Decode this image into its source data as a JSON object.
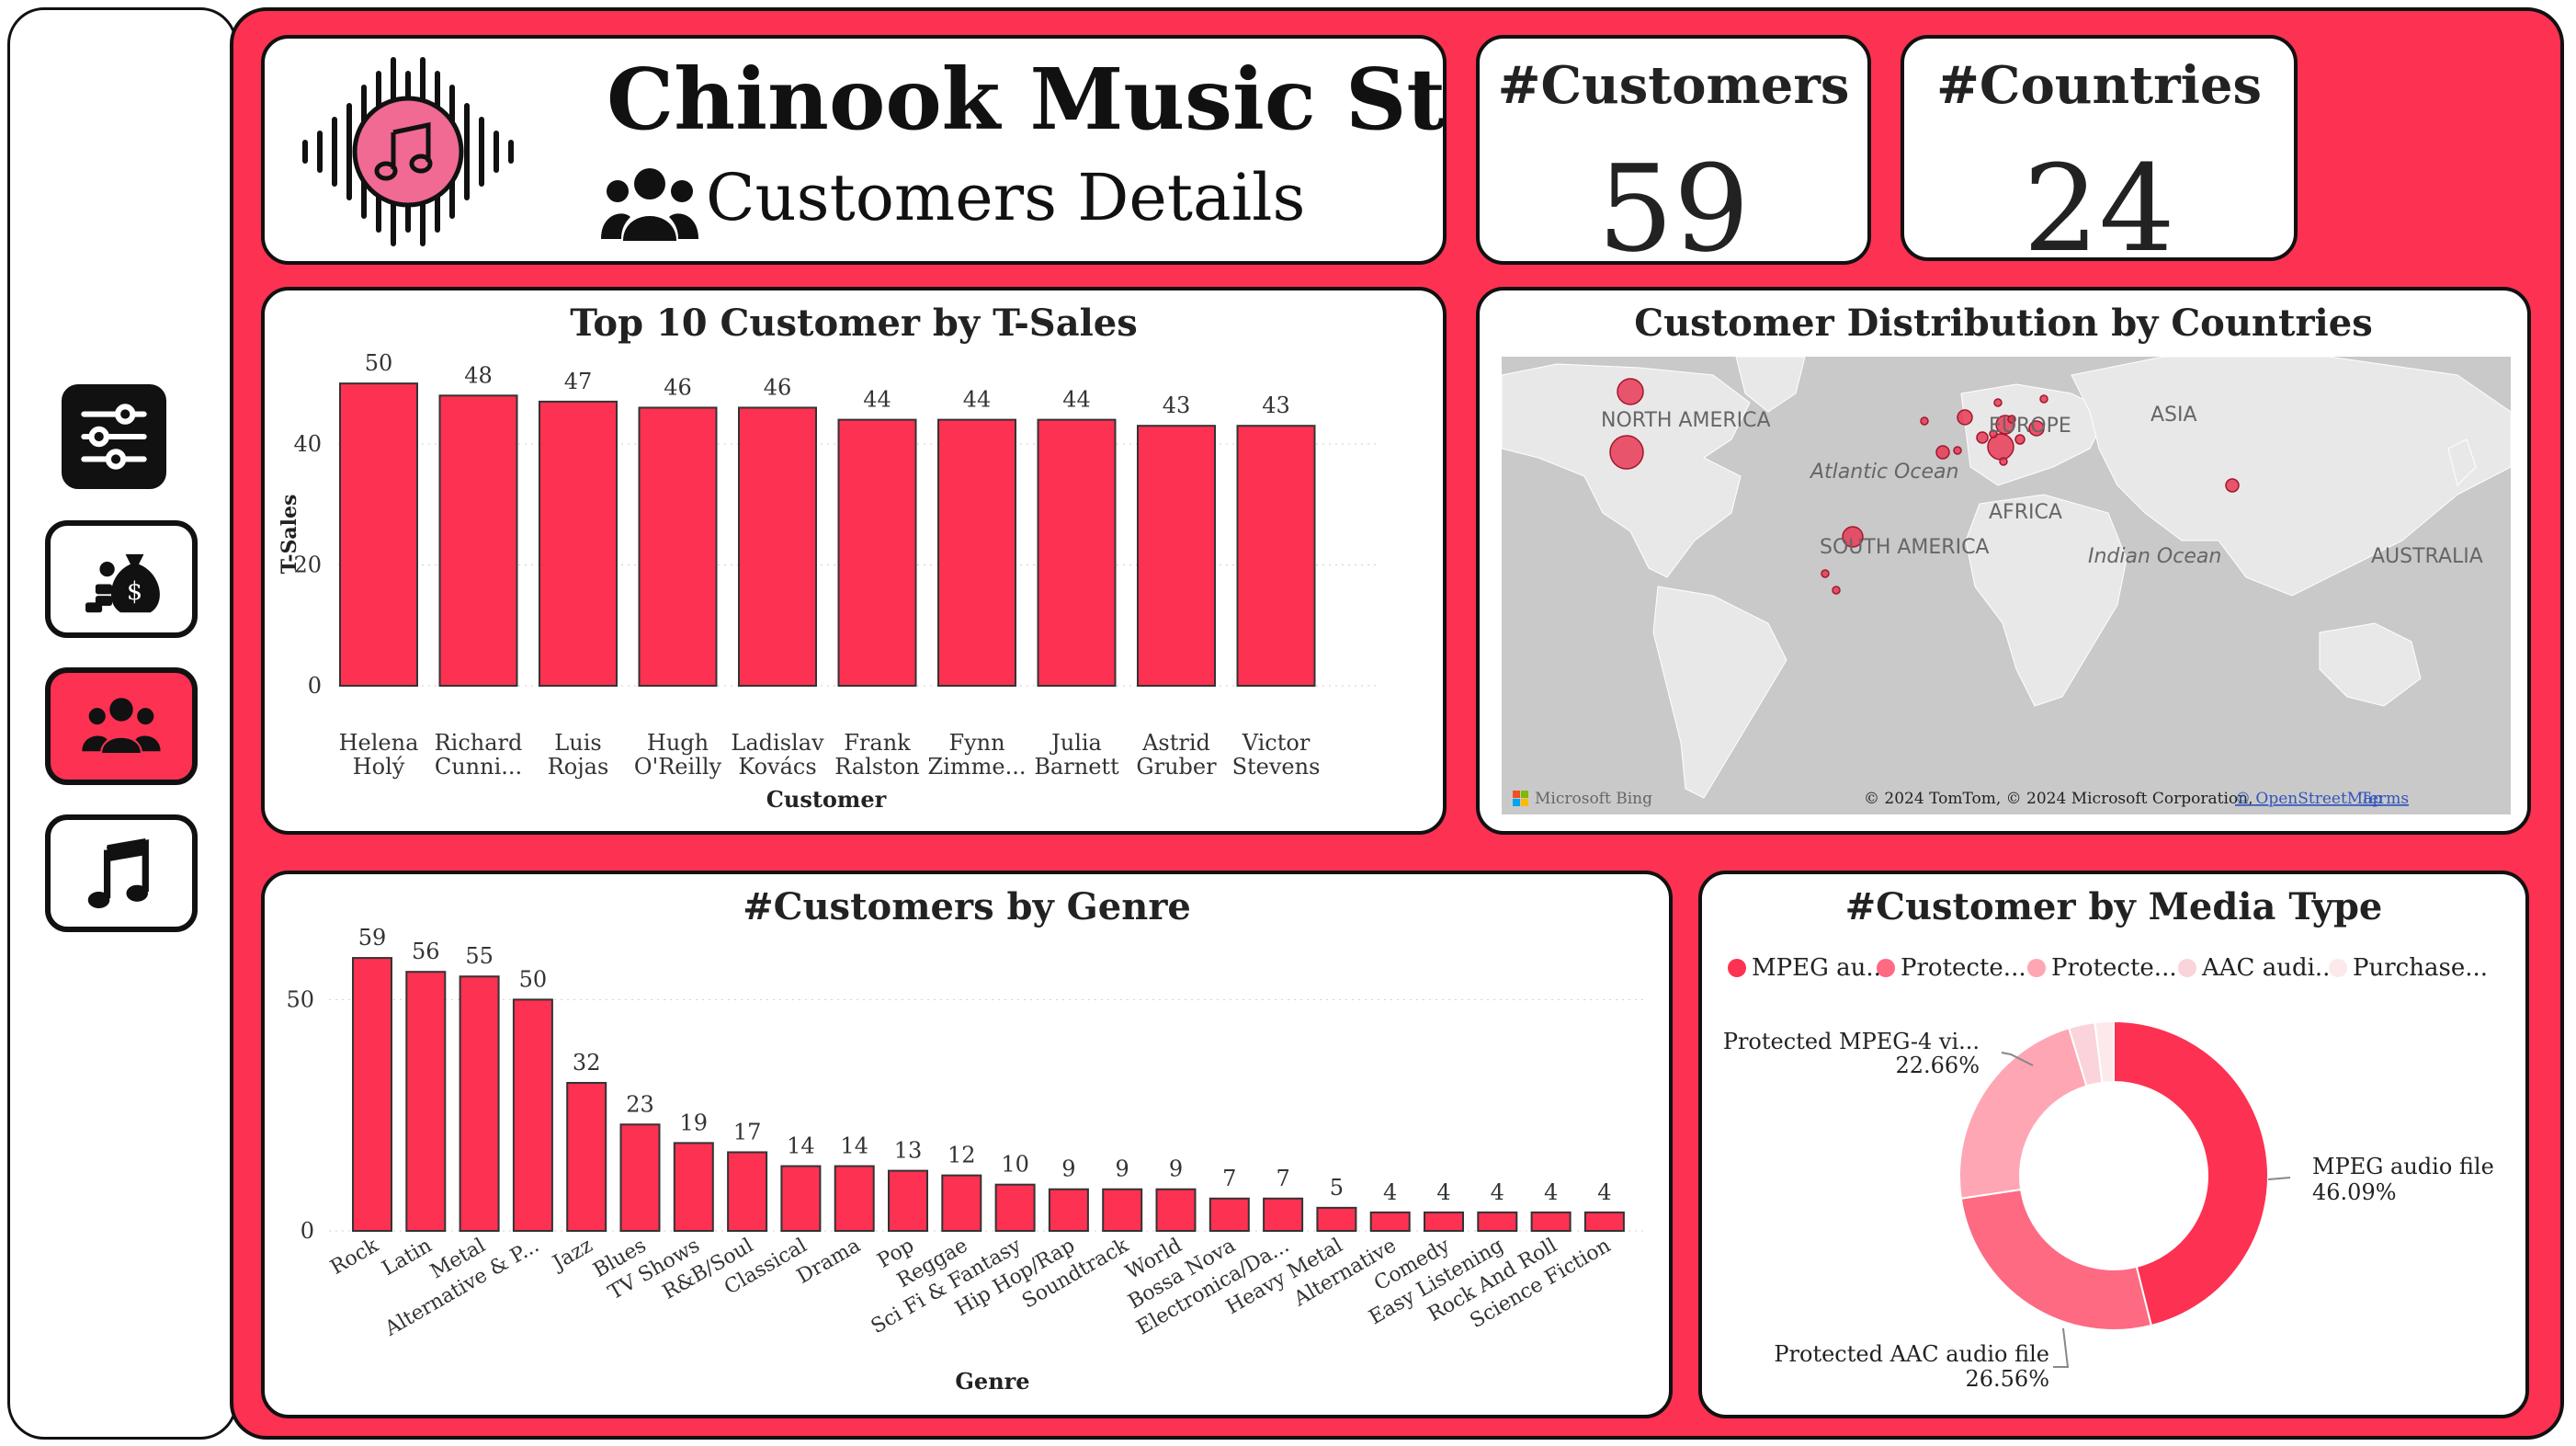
{
  "header": {
    "title": "Chinook Music Store",
    "subtitle": "Customers Details"
  },
  "nav": {
    "items": [
      {
        "icon": "filter-sliders-icon"
      },
      {
        "icon": "money-bag-icon"
      },
      {
        "icon": "customers-group-icon",
        "active": true
      },
      {
        "icon": "music-note-icon"
      }
    ]
  },
  "kpis": {
    "customers": {
      "label": "#Customers",
      "value": "59"
    },
    "countries": {
      "label": "#Countries",
      "value": "24"
    }
  },
  "colors": {
    "accent": "#fd3152",
    "bar": "#fd3152",
    "bar_stroke": "#333333",
    "map_land": "#e8e8e8",
    "map_water": "#c9c9c9",
    "bubble": "#e83a55"
  },
  "top_customers_chart": {
    "title": "Top 10 Customer by T-Sales",
    "xlabel": "Customer",
    "ylabel": "T-Sales",
    "y_ticks": [
      0,
      20,
      40
    ],
    "ylim": [
      0,
      52
    ]
  },
  "map": {
    "title": "Customer Distribution by Countries",
    "labels": {
      "north_america": "NORTH AMERICA",
      "europe": "EUROPE",
      "asia": "ASIA",
      "atlantic": "Atlantic Ocean",
      "africa": "AFRICA",
      "south_america": "SOUTH AMERICA",
      "indian": "Indian Ocean",
      "australia": "AUSTRALIA"
    },
    "brand": "Microsoft Bing",
    "copyright": "© 2024 TomTom, © 2024 Microsoft Corporation,",
    "osm_link": "© OpenStreetMap",
    "terms_link": "Terms"
  },
  "genre_chart": {
    "title": "#Customers by Genre",
    "xlabel": "Genre",
    "y_ticks": [
      0,
      50
    ],
    "ylim": [
      0,
      62
    ]
  },
  "media_chart": {
    "title": "#Customer by Media Type",
    "legend": [
      "MPEG au...",
      "Protecte...",
      "Protecte...",
      "AAC audi...",
      "Purchase..."
    ],
    "callouts": {
      "mpeg": {
        "name": "MPEG audio file",
        "pct": "46.09%"
      },
      "aac": {
        "name": "Protected AAC audio file",
        "pct": "26.56%"
      },
      "mp4": {
        "name": "Protected MPEG-4 vi...",
        "pct": "22.66%"
      }
    }
  },
  "chart_data": [
    {
      "type": "bar",
      "title": "Top 10 Customer by T-Sales",
      "xlabel": "Customer",
      "ylabel": "T-Sales",
      "categories": [
        "Helena Holý",
        "Richard Cunni...",
        "Luis Rojas",
        "Hugh O'Reilly",
        "Ladislav Kovács",
        "Frank Ralston",
        "Fynn Zimme...",
        "Julia Barnett",
        "Astrid Gruber",
        "Victor Stevens"
      ],
      "category_lines": [
        [
          "Helena",
          "Holý"
        ],
        [
          "Richard",
          "Cunni..."
        ],
        [
          "Luis",
          "Rojas"
        ],
        [
          "Hugh",
          "O'Reilly"
        ],
        [
          "Ladislav",
          "Kovács"
        ],
        [
          "Frank",
          "Ralston"
        ],
        [
          "Fynn",
          "Zimme..."
        ],
        [
          "Julia",
          "Barnett"
        ],
        [
          "Astrid",
          "Gruber"
        ],
        [
          "Victor",
          "Stevens"
        ]
      ],
      "values": [
        50,
        48,
        47,
        46,
        46,
        44,
        44,
        44,
        43,
        43
      ],
      "ylim": [
        0,
        52
      ]
    },
    {
      "type": "bar",
      "title": "#Customers by Genre",
      "xlabel": "Genre",
      "ylabel": "",
      "categories": [
        "Rock",
        "Latin",
        "Metal",
        "Alternative & P...",
        "Jazz",
        "Blues",
        "TV Shows",
        "R&B/Soul",
        "Classical",
        "Drama",
        "Pop",
        "Reggae",
        "Sci Fi & Fantasy",
        "Hip Hop/Rap",
        "Soundtrack",
        "World",
        "Bossa Nova",
        "Electronica/Da...",
        "Heavy Metal",
        "Alternative",
        "Comedy",
        "Easy Listening",
        "Rock And Roll",
        "Science Fiction"
      ],
      "values": [
        59,
        56,
        55,
        50,
        32,
        23,
        19,
        17,
        14,
        14,
        13,
        12,
        10,
        9,
        9,
        9,
        7,
        7,
        5,
        4,
        4,
        4,
        4,
        4
      ],
      "ylim": [
        0,
        62
      ]
    },
    {
      "type": "pie",
      "title": "#Customer by Media Type",
      "categories": [
        "MPEG audio file",
        "Protected AAC audio file",
        "Protected MPEG-4 vi...",
        "AAC audi...",
        "Purchase..."
      ],
      "values": [
        46.09,
        26.56,
        22.66,
        2.73,
        1.96
      ],
      "colors": [
        "#fd3152",
        "#fd6a82",
        "#fea6b3",
        "#fbd3da",
        "#fde9ec"
      ]
    }
  ]
}
